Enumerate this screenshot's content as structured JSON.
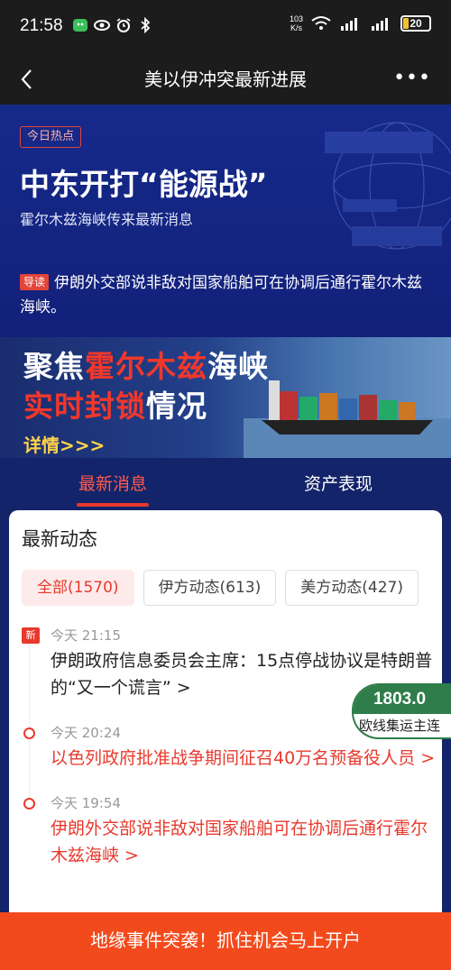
{
  "status_bar": {
    "time": "21:58",
    "speed_value": "103",
    "speed_unit": "K/s",
    "battery": "20",
    "battery_level_percent": 20,
    "icons": [
      "wechat-icon",
      "eye-icon",
      "alarm-icon",
      "bluetooth-icon",
      "wifi-icon",
      "signal-icon",
      "signal-icon"
    ]
  },
  "nav": {
    "title": "美以伊冲突最新进展",
    "more": "•••"
  },
  "hero": {
    "badge": "今日热点",
    "title": "中东开打“能源战”",
    "subtitle": "霍尔木兹海峡传来最新消息",
    "lead_tag": "导读",
    "lead_text": "伊朗外交部说非敌对国家船舶可在协调后通行霍尔木兹海峡。"
  },
  "banner": {
    "line1_a": "聚焦",
    "line1_b": "霍尔木兹",
    "line1_c": "海峡",
    "line2_a": "实时封锁",
    "line2_b": "情况",
    "more": "详情>>>"
  },
  "tabs": [
    {
      "label": "最新消息",
      "active": true
    },
    {
      "label": "资产表现",
      "active": false
    }
  ],
  "feed": {
    "title": "最新动态",
    "filters": [
      {
        "label": "全部(1570)",
        "active": true
      },
      {
        "label": "伊方动态(613)",
        "active": false
      },
      {
        "label": "美方动态(427)",
        "active": false
      }
    ],
    "items": [
      {
        "tag": "新",
        "time": "今天 21:15",
        "text": "伊朗政府信息委员会主席：15点停战协议是特朗普的“又一个谎言”",
        "arrow": " >",
        "hot": false
      },
      {
        "time": "今天 20:24",
        "text": "以色列政府批准战争期间征召40万名预备役人员",
        "arrow": " >",
        "hot": true
      },
      {
        "time": "今天 19:54",
        "text": "伊朗外交部说非敌对国家船舶可在协调后通行霍尔木兹海峡",
        "arrow": " >",
        "hot": true
      }
    ]
  },
  "ticker": {
    "value": "1803.0",
    "name": "欧线集运主连"
  },
  "cta": {
    "label": "地缘事件突袭！抓住机会马上开户"
  },
  "colors": {
    "accent_red": "#e8392d",
    "hero_blue": "#162a8a",
    "cta_orange": "#f24a1c",
    "ticker_green": "#2e7d4a"
  }
}
